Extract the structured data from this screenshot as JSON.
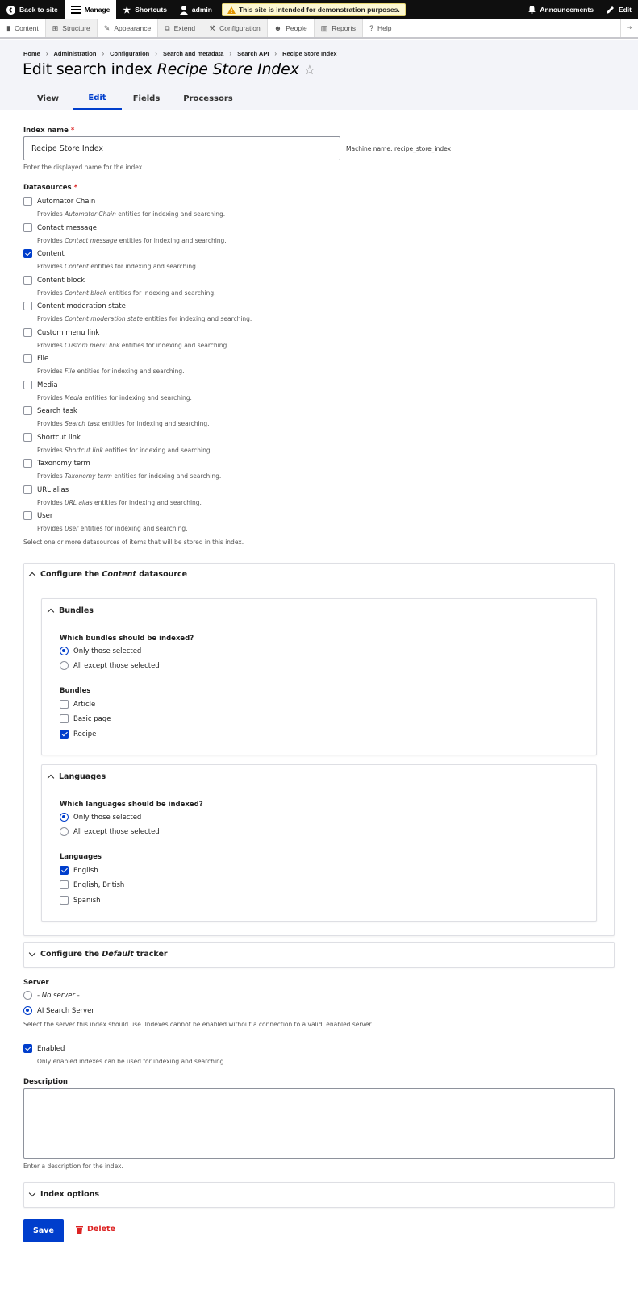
{
  "toolbar": {
    "back": "Back to site",
    "manage": "Manage",
    "shortcuts": "Shortcuts",
    "user": "admin",
    "warning": "This site is intended for demonstration purposes.",
    "announcements": "Announcements",
    "edit": "Edit"
  },
  "tray": [
    "Content",
    "Structure",
    "Appearance",
    "Extend",
    "Configuration",
    "People",
    "Reports",
    "Help"
  ],
  "breadcrumb": [
    "Home",
    "Administration",
    "Configuration",
    "Search and metadata",
    "Search API",
    "Recipe Store Index"
  ],
  "title": {
    "prefix": "Edit search index",
    "name": "Recipe Store Index"
  },
  "tabs": [
    "View",
    "Edit",
    "Fields",
    "Processors"
  ],
  "index_name": {
    "label": "Index name",
    "value": "Recipe Store Index",
    "machine_name": "Machine name: recipe_store_index",
    "description": "Enter the displayed name for the index."
  },
  "datasources": {
    "label": "Datasources",
    "items": [
      {
        "label": "Automator Chain",
        "entity": "Automator Chain",
        "checked": false
      },
      {
        "label": "Contact message",
        "entity": "Contact message",
        "checked": false
      },
      {
        "label": "Content",
        "entity": "Content",
        "checked": true
      },
      {
        "label": "Content block",
        "entity": "Content block",
        "checked": false
      },
      {
        "label": "Content moderation state",
        "entity": "Content moderation state",
        "checked": false
      },
      {
        "label": "Custom menu link",
        "entity": "Custom menu link",
        "checked": false
      },
      {
        "label": "File",
        "entity": "File",
        "checked": false
      },
      {
        "label": "Media",
        "entity": "Media",
        "checked": false
      },
      {
        "label": "Search task",
        "entity": "Search task",
        "checked": false
      },
      {
        "label": "Shortcut link",
        "entity": "Shortcut link",
        "checked": false
      },
      {
        "label": "Taxonomy term",
        "entity": "Taxonomy term",
        "checked": false
      },
      {
        "label": "URL alias",
        "entity": "URL alias",
        "checked": false
      },
      {
        "label": "User",
        "entity": "User",
        "checked": false
      }
    ],
    "desc_prefix": "Provides",
    "desc_suffix": "entities for indexing and searching.",
    "description": "Select one or more datasources of items that will be stored in this index."
  },
  "configure_content": {
    "title_prefix": "Configure the",
    "title_name": "Content",
    "title_suffix": "datasource",
    "bundles": {
      "title": "Bundles",
      "question": "Which bundles should be indexed?",
      "options": [
        {
          "label": "Only those selected",
          "selected": true
        },
        {
          "label": "All except those selected",
          "selected": false
        }
      ],
      "list_label": "Bundles",
      "items": [
        {
          "label": "Article",
          "checked": false
        },
        {
          "label": "Basic page",
          "checked": false
        },
        {
          "label": "Recipe",
          "checked": true
        }
      ]
    },
    "languages": {
      "title": "Languages",
      "question": "Which languages should be indexed?",
      "options": [
        {
          "label": "Only those selected",
          "selected": true
        },
        {
          "label": "All except those selected",
          "selected": false
        }
      ],
      "list_label": "Languages",
      "items": [
        {
          "label": "English",
          "checked": true
        },
        {
          "label": "English, British",
          "checked": false
        },
        {
          "label": "Spanish",
          "checked": false
        }
      ]
    }
  },
  "tracker": {
    "title_prefix": "Configure the",
    "title_name": "Default",
    "title_suffix": "tracker"
  },
  "server": {
    "label": "Server",
    "options": [
      {
        "label": "- No server -",
        "selected": false
      },
      {
        "label": "AI Search Server",
        "selected": true
      }
    ],
    "description": "Select the server this index should use. Indexes cannot be enabled without a connection to a valid, enabled server."
  },
  "enabled": {
    "label": "Enabled",
    "checked": true,
    "description": "Only enabled indexes can be used for indexing and searching."
  },
  "description_field": {
    "label": "Description",
    "value": "",
    "description": "Enter a description for the index."
  },
  "index_options": {
    "title": "Index options"
  },
  "actions": {
    "save": "Save",
    "delete": "Delete"
  },
  "colors": {
    "accent": "#003ecc",
    "danger": "#dc2323",
    "toolbar": "#0f0f0f",
    "header_bg": "#f3f4f9"
  }
}
